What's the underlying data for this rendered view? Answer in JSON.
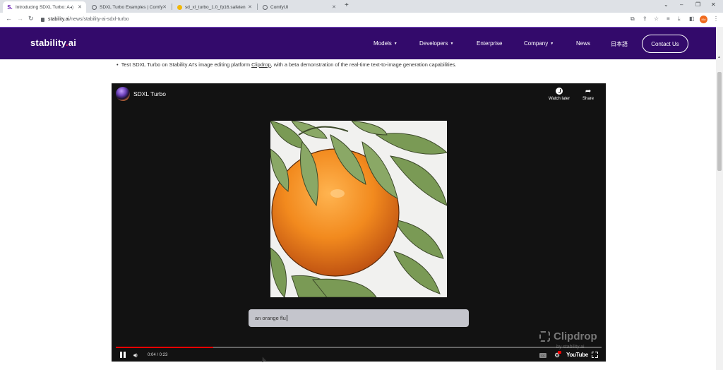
{
  "browser": {
    "tabs": [
      {
        "title": "Introducing SDXL Turbo: A",
        "favicon": "stability-s-icon",
        "active": true,
        "audio": true
      },
      {
        "title": "SDXL Turbo Examples | Comfy",
        "favicon": "globe-icon",
        "active": false
      },
      {
        "title": "sd_xl_turbo_1.0_fp16.safeten",
        "favicon": "huggingface-icon",
        "active": false
      },
      {
        "title": "ComfyUI",
        "favicon": "globe-icon",
        "active": false
      }
    ],
    "new_tab_label": "+",
    "url_host": "stability.ai",
    "url_path": "/news/stability-ai-sdxl-turbo",
    "profile_initials": "KM",
    "window_controls": {
      "minimize": "–",
      "restore": "❐",
      "close": "✕",
      "tabsearch": "⌄"
    }
  },
  "site": {
    "logo_text_a": "stability",
    "logo_dot": ".",
    "logo_text_b": "ai",
    "nav": [
      {
        "label": "Models",
        "dropdown": true
      },
      {
        "label": "Developers",
        "dropdown": true
      },
      {
        "label": "Enterprise",
        "dropdown": false
      },
      {
        "label": "Company",
        "dropdown": true
      },
      {
        "label": "News",
        "dropdown": false
      },
      {
        "label": "日本語",
        "dropdown": false
      }
    ],
    "contact_label": "Contact Us",
    "caret": "▼"
  },
  "content": {
    "bullet_prefix": "Test SDXL Turbo on Stability AI's image editing platform ",
    "bullet_link": "Clipdrop",
    "bullet_suffix": ", with a beta demonstration of the real-time text-to-image generation capabilities."
  },
  "video": {
    "title": "SDXL Turbo",
    "watch_later_label": "Watch later",
    "share_label": "Share",
    "prompt_text": "an orange flu",
    "watermark": "Clipdrop",
    "watermark_sub": "by stability.ai",
    "current_time": "0:04",
    "duration": "0:23",
    "time_display": "0:04 / 0:23",
    "progress_fraction": 0.2,
    "youtube_label": "YouTube",
    "cc_label": "CC",
    "accent_color": "#ff0000"
  },
  "colors": {
    "nav_bg": "#330a6b",
    "player_bg": "#121212"
  }
}
